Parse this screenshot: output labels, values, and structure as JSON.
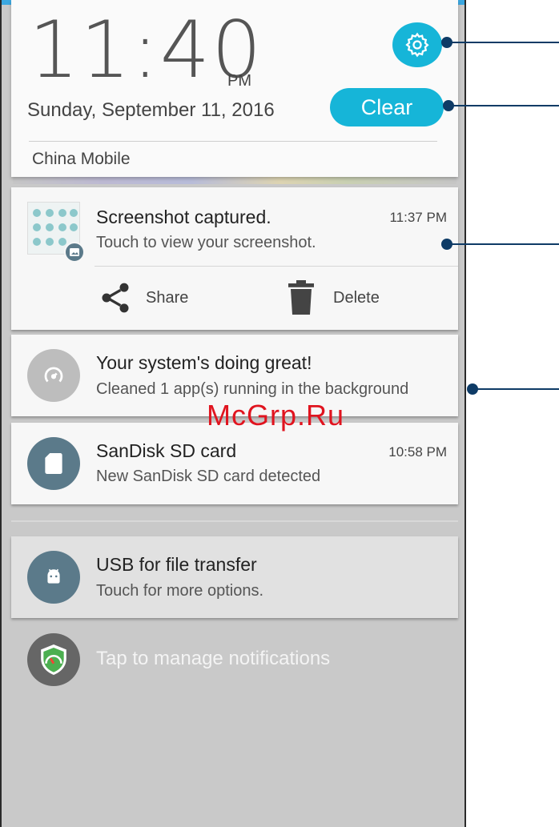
{
  "header": {
    "time": "11:40",
    "ampm": "PM",
    "date": "Sunday, September 11, 2016",
    "carrier": "China Mobile",
    "clear_label": "Clear"
  },
  "notifications": {
    "screenshot": {
      "title": "Screenshot captured.",
      "time": "11:37 PM",
      "subtitle": "Touch to view your screenshot.",
      "share_label": "Share",
      "delete_label": "Delete"
    },
    "system": {
      "title": "Your system's doing great!",
      "subtitle": "Cleaned 1 app(s) running in the background"
    },
    "sandisk": {
      "title": "SanDisk SD card",
      "time": "10:58 PM",
      "subtitle": "New SanDisk SD card detected"
    },
    "usb": {
      "title": "USB for file transfer",
      "subtitle": "Touch for more options."
    }
  },
  "manage": {
    "label": "Tap to manage notifications"
  },
  "watermark": "McGrp.Ru",
  "colors": {
    "accent": "#16b5d8",
    "callout": "#0e3b66",
    "icon_slate": "#5b7a8a"
  }
}
